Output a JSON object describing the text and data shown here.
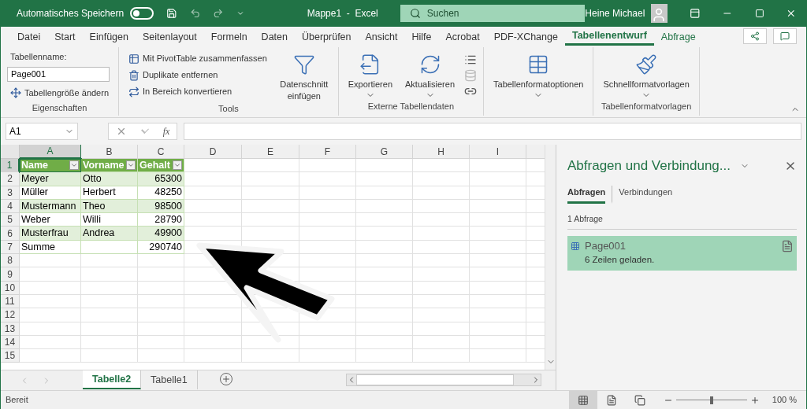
{
  "title_bar": {
    "autosave_label": "Automatisches Speichern",
    "autosave_on": false,
    "title": "Mappe1  -  Excel",
    "search_placeholder": "Suchen",
    "user": "Heine Michael"
  },
  "menu_tabs": [
    {
      "label": "Datei",
      "selected": false,
      "contextual": false
    },
    {
      "label": "Start",
      "selected": false,
      "contextual": false
    },
    {
      "label": "Einfügen",
      "selected": false,
      "contextual": false
    },
    {
      "label": "Seitenlayout",
      "selected": false,
      "contextual": false
    },
    {
      "label": "Formeln",
      "selected": false,
      "contextual": false
    },
    {
      "label": "Daten",
      "selected": false,
      "contextual": false
    },
    {
      "label": "Überprüfen",
      "selected": false,
      "contextual": false
    },
    {
      "label": "Ansicht",
      "selected": false,
      "contextual": false
    },
    {
      "label": "Hilfe",
      "selected": false,
      "contextual": false
    },
    {
      "label": "Acrobat",
      "selected": false,
      "contextual": false
    },
    {
      "label": "PDF-XChange",
      "selected": false,
      "contextual": false
    },
    {
      "label": "Tabellenentwurf",
      "selected": true,
      "contextual": true
    },
    {
      "label": "Abfrage",
      "selected": false,
      "contextual": true
    }
  ],
  "ribbon_groups": [
    {
      "label": "Eigenschaften",
      "items": [
        {
          "kind": "label",
          "label": "Tabellenname:"
        },
        {
          "kind": "field",
          "value": "Page001"
        },
        {
          "kind": "small",
          "label": "Tabellengröße ändern"
        }
      ]
    },
    {
      "label": "Tools",
      "items": [
        {
          "kind": "small",
          "label": "Mit PivotTable zusammenfassen"
        },
        {
          "kind": "small",
          "label": "Duplikate entfernen"
        },
        {
          "kind": "small",
          "label": "In Bereich konvertieren"
        },
        {
          "kind": "large",
          "label": "Datenschnitt einfügen",
          "dropdown": false
        }
      ]
    },
    {
      "label": "Externe Tabellendaten",
      "items": [
        {
          "kind": "large",
          "label": "Exportieren",
          "dropdown": true
        },
        {
          "kind": "large",
          "label": "Aktualisieren",
          "dropdown": true
        },
        {
          "kind": "icons",
          "disabled": [
            false,
            true,
            false
          ]
        }
      ]
    },
    {
      "items": [
        {
          "kind": "large",
          "label": "Tabellenformatoptionen",
          "dropdown": true
        }
      ]
    },
    {
      "label": "Tabellenformatvorlagen",
      "items": [
        {
          "kind": "large",
          "label": "Schnellformatvorlagen",
          "dropdown": true
        }
      ]
    }
  ],
  "formula_bar": {
    "name_box": "A1",
    "function_label": "fx"
  },
  "columns": [
    {
      "label": "A",
      "selected": true
    },
    {
      "label": "B",
      "selected": false
    },
    {
      "label": "C",
      "selected": false
    },
    {
      "label": "D",
      "selected": false
    },
    {
      "label": "E",
      "selected": false
    },
    {
      "label": "F",
      "selected": false
    },
    {
      "label": "G",
      "selected": false
    },
    {
      "label": "H",
      "selected": false
    },
    {
      "label": "I",
      "selected": false
    }
  ],
  "rows": [
    {
      "label": "1",
      "selected": true
    },
    {
      "label": "2",
      "selected": false
    },
    {
      "label": "3",
      "selected": false
    },
    {
      "label": "4",
      "selected": false
    },
    {
      "label": "5",
      "selected": false
    },
    {
      "label": "6",
      "selected": false
    },
    {
      "label": "7",
      "selected": false
    },
    {
      "label": "8",
      "selected": false
    },
    {
      "label": "9",
      "selected": false
    },
    {
      "label": "10",
      "selected": false
    },
    {
      "label": "11",
      "selected": false
    },
    {
      "label": "12",
      "selected": false
    },
    {
      "label": "13",
      "selected": false
    },
    {
      "label": "14",
      "selected": false
    },
    {
      "label": "15",
      "selected": false
    }
  ],
  "table": {
    "header": [
      "Name",
      "Vorname",
      "Gehalt"
    ],
    "rows": [
      [
        "Meyer",
        "Otto",
        "65300"
      ],
      [
        "Müller",
        "Herbert",
        "48250"
      ],
      [
        "Mustermann",
        "Theo",
        "98500"
      ],
      [
        "Weber",
        "Willi",
        "28790"
      ],
      [
        "Musterfrau",
        "Andrea",
        "49900"
      ]
    ],
    "total_row": {
      "label": "Summe",
      "value": "290740"
    }
  },
  "pane": {
    "title": "Abfragen und Verbindung...",
    "tabs": [
      {
        "label": "Abfragen",
        "selected": true
      },
      {
        "label": "Verbindungen",
        "selected": false
      }
    ],
    "count": "1 Abfrage",
    "queries": [
      {
        "name": "Page001",
        "status": "6 Zeilen geladen."
      }
    ]
  },
  "sheet_tabs": [
    {
      "label": "Tabelle2",
      "selected": true
    },
    {
      "label": "Tabelle1",
      "selected": false
    }
  ],
  "status_bar": {
    "status": "Bereit",
    "views": [
      {
        "kind": "normal",
        "selected": true
      },
      {
        "kind": "layout",
        "selected": false
      },
      {
        "kind": "pagebreak",
        "selected": false
      }
    ],
    "zoom": {
      "level": 0.5,
      "reading": "100 %"
    }
  }
}
